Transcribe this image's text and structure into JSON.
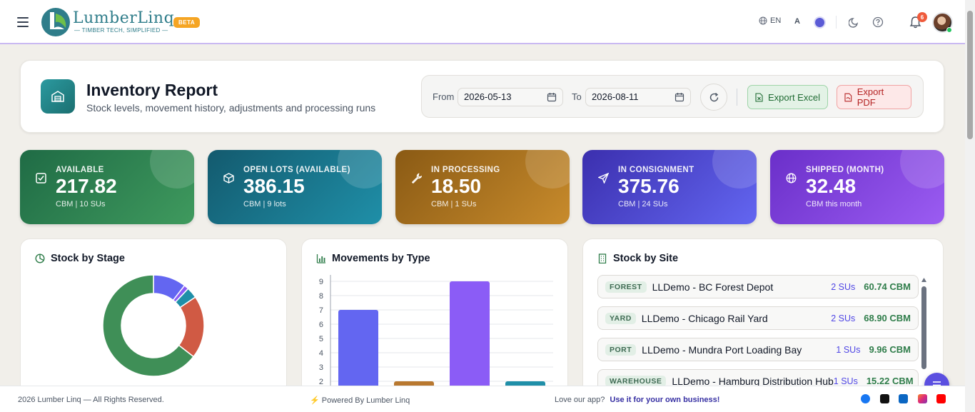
{
  "header": {
    "brand": "LumberLinq",
    "tagline": "— TIMBER TECH, SIMPLIFIED —",
    "beta": "BETA",
    "lang": "EN",
    "font_size": "A",
    "notifications": "6"
  },
  "page": {
    "title": "Inventory Report",
    "subtitle": "Stock levels, movement history, adjustments and processing runs",
    "from_label": "From",
    "from_date": "2026-05-13",
    "to_label": "To",
    "to_date": "2026-08-11",
    "export_excel": "Export Excel",
    "export_pdf": "Export PDF"
  },
  "kpis": [
    {
      "label": "AVAILABLE",
      "value": "217.82",
      "sub": "CBM | 10 SUs",
      "color_from": "#1f6b45",
      "color_to": "#3f9a5e"
    },
    {
      "label": "OPEN LOTS (AVAILABLE)",
      "value": "386.15",
      "sub": "CBM | 9 lots",
      "color_from": "#135a6e",
      "color_to": "#1f8fa8"
    },
    {
      "label": "IN PROCESSING",
      "value": "18.50",
      "sub": "CBM | 1 SUs",
      "color_from": "#8a5a14",
      "color_to": "#c88b2c"
    },
    {
      "label": "IN CONSIGNMENT",
      "value": "375.76",
      "sub": "CBM | 24 SUs",
      "color_from": "#3b2fae",
      "color_to": "#6366f1"
    },
    {
      "label": "SHIPPED (MONTH)",
      "value": "32.48",
      "sub": "CBM this month",
      "color_from": "#6a2fc9",
      "color_to": "#9b5cf2"
    }
  ],
  "panels": {
    "stage_title": "Stock by Stage",
    "movements_title": "Movements by Type",
    "site_title": "Stock by Site"
  },
  "chart_data": [
    {
      "type": "pie",
      "title": "Stock by Stage",
      "slices": [
        {
          "value": 10.5,
          "color": "#6366f1"
        },
        {
          "value": 1.5,
          "color": "#8b5cf6"
        },
        {
          "value": 3.5,
          "color": "#1f8fa8"
        },
        {
          "value": 20,
          "color": "#d05a44"
        },
        {
          "value": 64.5,
          "color": "#3f8f57"
        }
      ]
    },
    {
      "type": "bar",
      "title": "Movements by Type",
      "yticks": [
        2,
        3,
        4,
        5,
        6,
        7,
        8,
        9
      ],
      "ylim": [
        0,
        9.6
      ],
      "values": [
        7,
        2,
        9,
        2
      ],
      "colors": [
        "#6366f1",
        "#b8782f",
        "#8b5cf6",
        "#1f8fa8"
      ]
    }
  ],
  "sites": [
    {
      "tag": "FOREST",
      "name": "LLDemo - BC Forest Depot",
      "units": "2 SUs",
      "cbm": "60.74 CBM"
    },
    {
      "tag": "YARD",
      "name": "LLDemo - Chicago Rail Yard",
      "units": "2 SUs",
      "cbm": "68.90 CBM"
    },
    {
      "tag": "PORT",
      "name": "LLDemo - Mundra Port Loading Bay",
      "units": "1 SUs",
      "cbm": "9.96 CBM"
    },
    {
      "tag": "WAREHOUSE",
      "name": "LLDemo - Hamburg Distribution Hub",
      "units": "1 SUs",
      "cbm": "15.22 CBM"
    }
  ],
  "footer": {
    "copyright": "2026 Lumber Linq — All Rights Reserved.",
    "powered": "Powered By Lumber Linq",
    "love": "Love our app?",
    "cta": "Use it for your own business!"
  }
}
